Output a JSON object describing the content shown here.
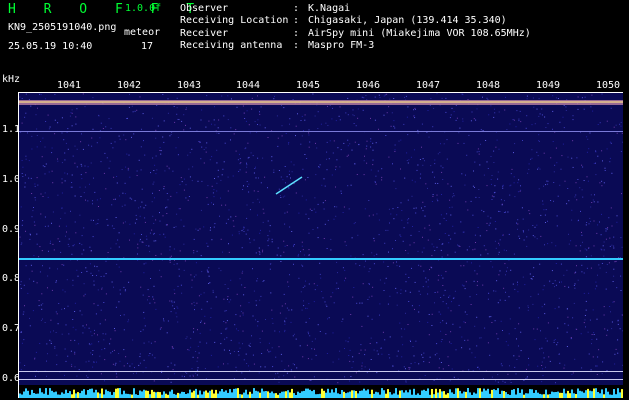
{
  "header": {
    "app_name": "H R O F F T",
    "version": "1.0.0f",
    "filename": "KN9_2505191040.png",
    "datetime": "25.05.19 10:40",
    "meteor_label": "meteor",
    "meteor_count": "17"
  },
  "info": [
    {
      "label": "Observer",
      "colon": ":",
      "value": "K.Nagai"
    },
    {
      "label": "Receiving Location",
      "colon": ":",
      "value": "Chigasaki, Japan (139.414 35.340)"
    },
    {
      "label": "Receiver",
      "colon": ":",
      "value": "AirSpy mini (Miakejima VOR 108.65MHz)"
    },
    {
      "label": "Receiving antenna",
      "colon": ":",
      "value": "Maspro FM-3"
    }
  ],
  "axes": {
    "y_unit": "kHz",
    "y_ticks": [
      "1.1",
      "1.0",
      "0.9",
      "0.8",
      "0.7",
      "0.6"
    ],
    "x_ticks": [
      "1041",
      "1042",
      "1043",
      "1044",
      "1045",
      "1046",
      "1047",
      "1048",
      "1049",
      "1050"
    ]
  },
  "colors": {
    "background": "#000000",
    "spectrogram_noise": "#0a0a55",
    "header_green": "#00ff33",
    "trace_cyan": "#33ccff",
    "noise_band_yellow": "#ffff33"
  }
}
